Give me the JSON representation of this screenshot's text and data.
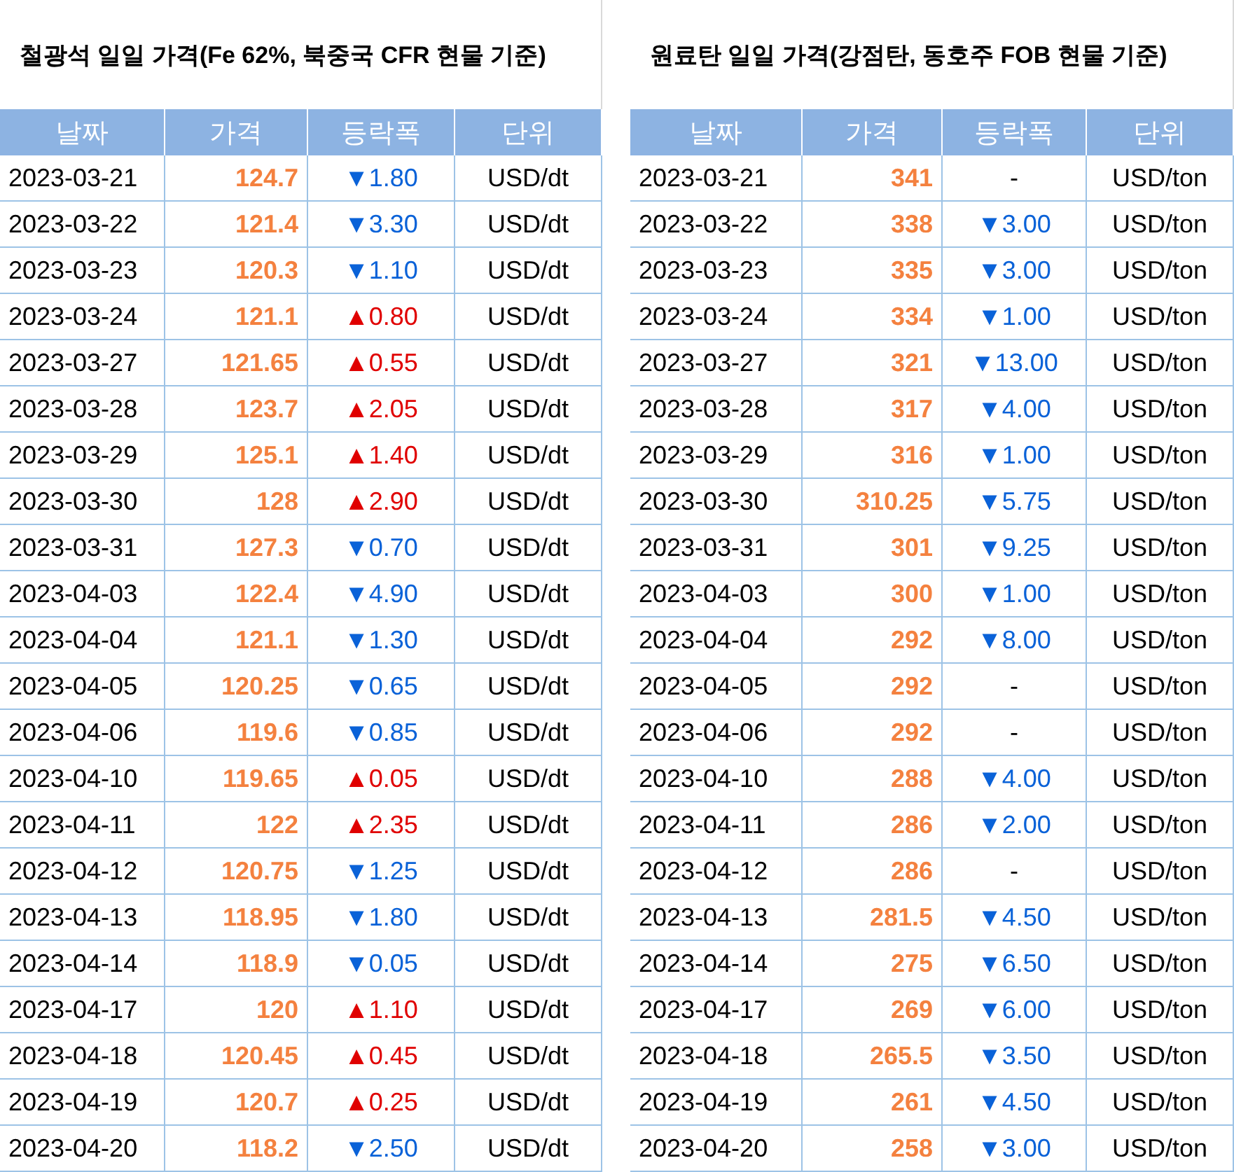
{
  "tables": [
    {
      "title": "철광석 일일 가격(Fe 62%, 북중국 CFR 현물 기준)",
      "columns": [
        "날짜",
        "가격",
        "등락폭",
        "단위"
      ],
      "rows": [
        {
          "date": "2023-03-21",
          "price": "124.7",
          "change": "▼1.80",
          "kind": "down",
          "unit": "USD/dt"
        },
        {
          "date": "2023-03-22",
          "price": "121.4",
          "change": "▼3.30",
          "kind": "down",
          "unit": "USD/dt"
        },
        {
          "date": "2023-03-23",
          "price": "120.3",
          "change": "▼1.10",
          "kind": "down",
          "unit": "USD/dt"
        },
        {
          "date": "2023-03-24",
          "price": "121.1",
          "change": "▲0.80",
          "kind": "up",
          "unit": "USD/dt"
        },
        {
          "date": "2023-03-27",
          "price": "121.65",
          "change": "▲0.55",
          "kind": "up",
          "unit": "USD/dt"
        },
        {
          "date": "2023-03-28",
          "price": "123.7",
          "change": "▲2.05",
          "kind": "up",
          "unit": "USD/dt"
        },
        {
          "date": "2023-03-29",
          "price": "125.1",
          "change": "▲1.40",
          "kind": "up",
          "unit": "USD/dt"
        },
        {
          "date": "2023-03-30",
          "price": "128",
          "change": "▲2.90",
          "kind": "up",
          "unit": "USD/dt"
        },
        {
          "date": "2023-03-31",
          "price": "127.3",
          "change": "▼0.70",
          "kind": "down",
          "unit": "USD/dt"
        },
        {
          "date": "2023-04-03",
          "price": "122.4",
          "change": "▼4.90",
          "kind": "down",
          "unit": "USD/dt"
        },
        {
          "date": "2023-04-04",
          "price": "121.1",
          "change": "▼1.30",
          "kind": "down",
          "unit": "USD/dt"
        },
        {
          "date": "2023-04-05",
          "price": "120.25",
          "change": "▼0.65",
          "kind": "down",
          "unit": "USD/dt"
        },
        {
          "date": "2023-04-06",
          "price": "119.6",
          "change": "▼0.85",
          "kind": "down",
          "unit": "USD/dt"
        },
        {
          "date": "2023-04-10",
          "price": "119.65",
          "change": "▲0.05",
          "kind": "up",
          "unit": "USD/dt"
        },
        {
          "date": "2023-04-11",
          "price": "122",
          "change": "▲2.35",
          "kind": "up",
          "unit": "USD/dt"
        },
        {
          "date": "2023-04-12",
          "price": "120.75",
          "change": "▼1.25",
          "kind": "down",
          "unit": "USD/dt"
        },
        {
          "date": "2023-04-13",
          "price": "118.95",
          "change": "▼1.80",
          "kind": "down",
          "unit": "USD/dt"
        },
        {
          "date": "2023-04-14",
          "price": "118.9",
          "change": "▼0.05",
          "kind": "down",
          "unit": "USD/dt"
        },
        {
          "date": "2023-04-17",
          "price": "120",
          "change": "▲1.10",
          "kind": "up",
          "unit": "USD/dt"
        },
        {
          "date": "2023-04-18",
          "price": "120.45",
          "change": "▲0.45",
          "kind": "up",
          "unit": "USD/dt"
        },
        {
          "date": "2023-04-19",
          "price": "120.7",
          "change": "▲0.25",
          "kind": "up",
          "unit": "USD/dt"
        },
        {
          "date": "2023-04-20",
          "price": "118.2",
          "change": "▼2.50",
          "kind": "down",
          "unit": "USD/dt"
        }
      ]
    },
    {
      "title": "원료탄 일일 가격(강점탄, 동호주 FOB 현물 기준)",
      "columns": [
        "날짜",
        "가격",
        "등락폭",
        "단위"
      ],
      "rows": [
        {
          "date": "2023-03-21",
          "price": "341",
          "change": "-",
          "kind": "none",
          "unit": "USD/ton"
        },
        {
          "date": "2023-03-22",
          "price": "338",
          "change": "▼3.00",
          "kind": "down",
          "unit": "USD/ton"
        },
        {
          "date": "2023-03-23",
          "price": "335",
          "change": "▼3.00",
          "kind": "down",
          "unit": "USD/ton"
        },
        {
          "date": "2023-03-24",
          "price": "334",
          "change": "▼1.00",
          "kind": "down",
          "unit": "USD/ton"
        },
        {
          "date": "2023-03-27",
          "price": "321",
          "change": "▼13.00",
          "kind": "down",
          "unit": "USD/ton"
        },
        {
          "date": "2023-03-28",
          "price": "317",
          "change": "▼4.00",
          "kind": "down",
          "unit": "USD/ton"
        },
        {
          "date": "2023-03-29",
          "price": "316",
          "change": "▼1.00",
          "kind": "down",
          "unit": "USD/ton"
        },
        {
          "date": "2023-03-30",
          "price": "310.25",
          "change": "▼5.75",
          "kind": "down",
          "unit": "USD/ton"
        },
        {
          "date": "2023-03-31",
          "price": "301",
          "change": "▼9.25",
          "kind": "down",
          "unit": "USD/ton"
        },
        {
          "date": "2023-04-03",
          "price": "300",
          "change": "▼1.00",
          "kind": "down",
          "unit": "USD/ton"
        },
        {
          "date": "2023-04-04",
          "price": "292",
          "change": "▼8.00",
          "kind": "down",
          "unit": "USD/ton"
        },
        {
          "date": "2023-04-05",
          "price": "292",
          "change": "-",
          "kind": "none",
          "unit": "USD/ton"
        },
        {
          "date": "2023-04-06",
          "price": "292",
          "change": "-",
          "kind": "none",
          "unit": "USD/ton"
        },
        {
          "date": "2023-04-10",
          "price": "288",
          "change": "▼4.00",
          "kind": "down",
          "unit": "USD/ton"
        },
        {
          "date": "2023-04-11",
          "price": "286",
          "change": "▼2.00",
          "kind": "down",
          "unit": "USD/ton"
        },
        {
          "date": "2023-04-12",
          "price": "286",
          "change": "-",
          "kind": "none",
          "unit": "USD/ton"
        },
        {
          "date": "2023-04-13",
          "price": "281.5",
          "change": "▼4.50",
          "kind": "down",
          "unit": "USD/ton"
        },
        {
          "date": "2023-04-14",
          "price": "275",
          "change": "▼6.50",
          "kind": "down",
          "unit": "USD/ton"
        },
        {
          "date": "2023-04-17",
          "price": "269",
          "change": "▼6.00",
          "kind": "down",
          "unit": "USD/ton"
        },
        {
          "date": "2023-04-18",
          "price": "265.5",
          "change": "▼3.50",
          "kind": "down",
          "unit": "USD/ton"
        },
        {
          "date": "2023-04-19",
          "price": "261",
          "change": "▼4.50",
          "kind": "down",
          "unit": "USD/ton"
        },
        {
          "date": "2023-04-20",
          "price": "258",
          "change": "▼3.00",
          "kind": "down",
          "unit": "USD/ton"
        }
      ]
    }
  ]
}
